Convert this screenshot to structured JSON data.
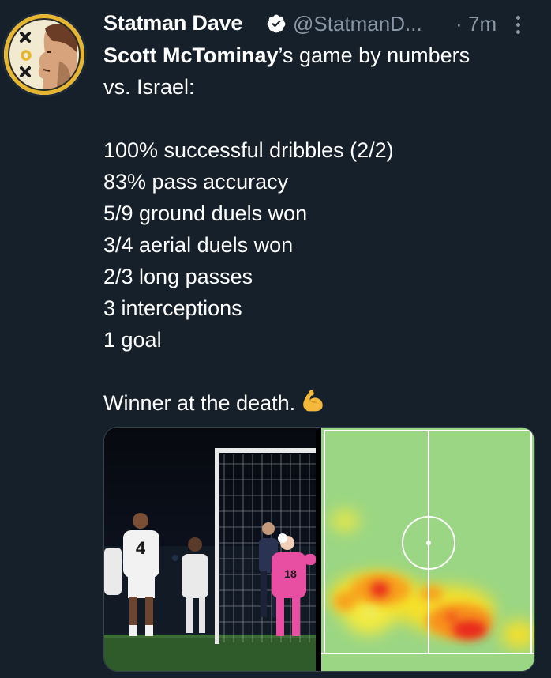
{
  "author": {
    "name": "Statman Dave",
    "handle": "@StatmanD...",
    "separator": "·",
    "time": "7m",
    "avatar_icon": "xox-logo-portrait-avatar",
    "verified_icon": "verified-badge-icon"
  },
  "tweet": {
    "line1_bold": "Scott McTominay",
    "line1_rest": "’s game by numbers",
    "line2": "vs. Israel:",
    "stats": [
      "100% successful dribbles (2/2)",
      "83% pass accuracy",
      "5/9 ground duels won",
      "3/4 aerial duels won",
      "2/3 long passes",
      "3 interceptions",
      "1 goal"
    ],
    "closing": "Winner at the death.",
    "closing_emoji": "flexed-biceps-emoji"
  },
  "media": {
    "photo_left": "goal-celebration-photo",
    "photo_right": "player-heatmap-image",
    "pitch_color": "#9ad684",
    "shirt_numbers": [
      "4",
      "18"
    ]
  },
  "colors": {
    "background": "#15202b",
    "text": "#ffffff",
    "muted": "#8b98a5",
    "verified": "#ffffff",
    "avatar_ring": "#e7b52e"
  }
}
